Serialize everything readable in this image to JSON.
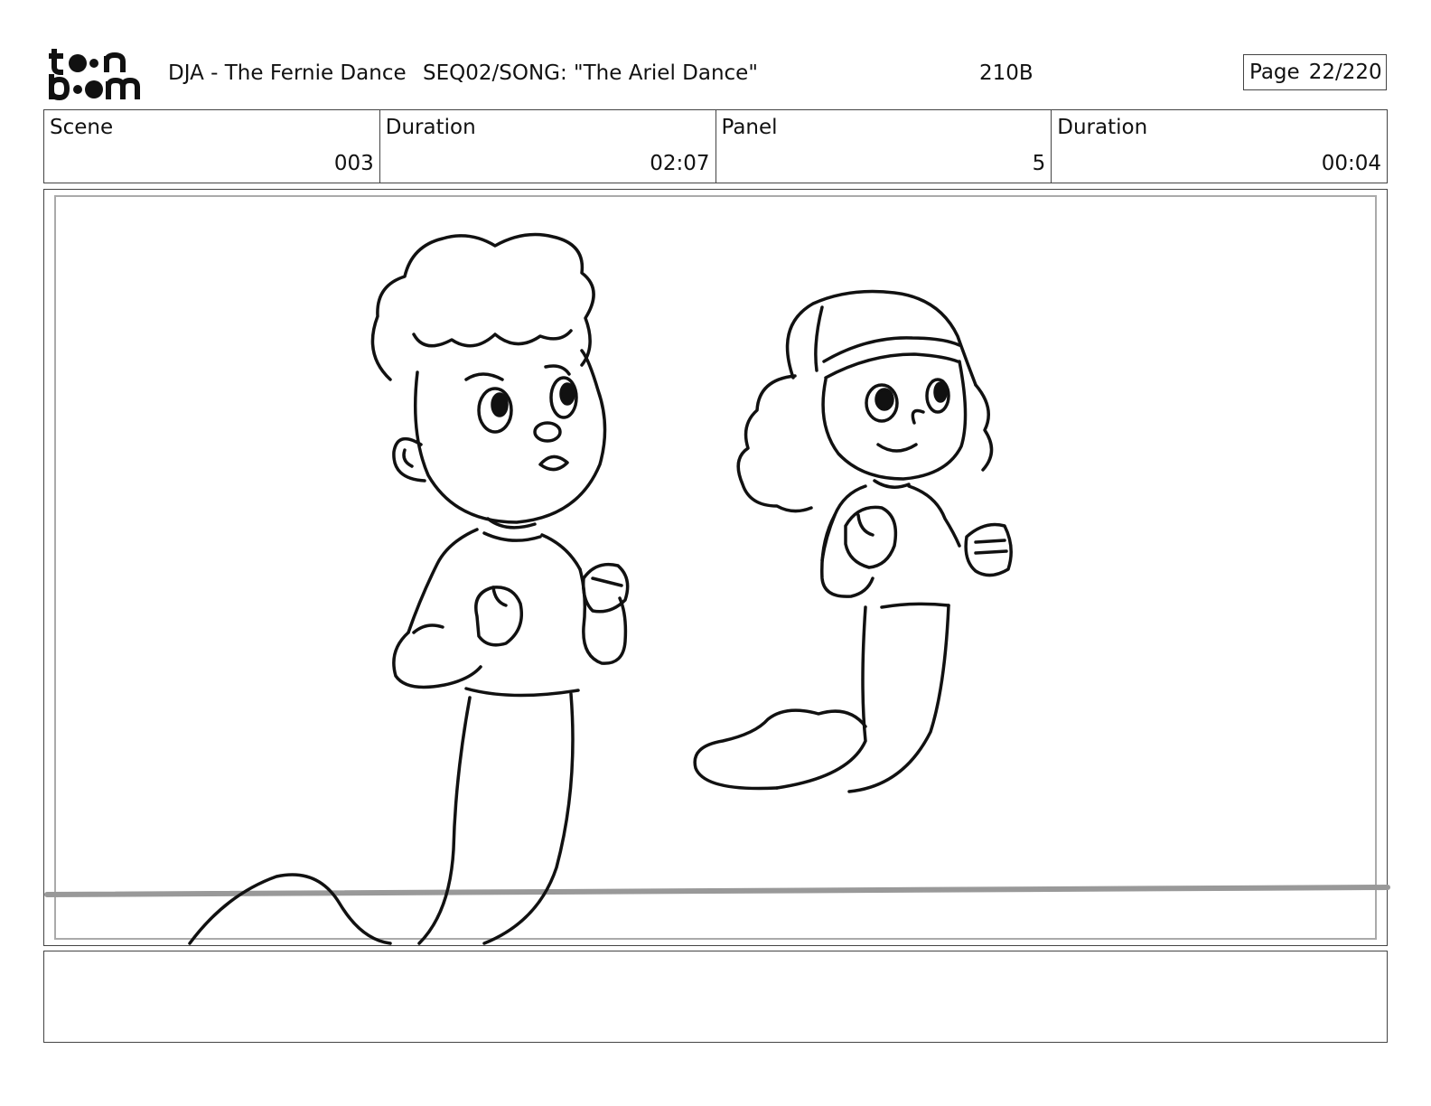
{
  "header": {
    "logo_top": "t●●n",
    "logo_bottom": "b●●m",
    "project": "DJA - The Fernie Dance",
    "sequence": "SEQ02/SONG: \"The Ariel Dance\"",
    "code": "210B",
    "page_label": "Page",
    "page_value": "22/220"
  },
  "info": {
    "scene_label": "Scene",
    "scene_value": "003",
    "scene_duration_label": "Duration",
    "scene_duration_value": "02:07",
    "panel_label": "Panel",
    "panel_value": "5",
    "panel_duration_label": "Duration",
    "panel_duration_value": "00:04"
  },
  "caption": ""
}
